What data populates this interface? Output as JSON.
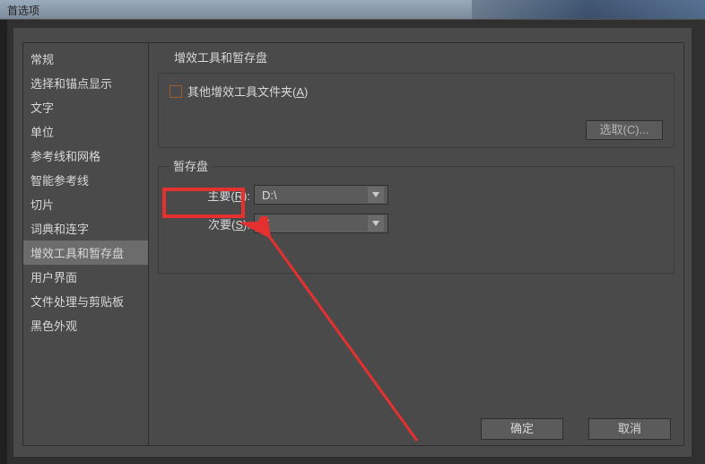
{
  "window": {
    "title": "首选项"
  },
  "sidebar": {
    "items": [
      "常规",
      "选择和锚点显示",
      "文字",
      "单位",
      "参考线和网格",
      "智能参考线",
      "切片",
      "词典和连字",
      "增效工具和暂存盘",
      "用户界面",
      "文件处理与剪贴板",
      "黑色外观"
    ],
    "selected_index": 8
  },
  "content": {
    "section_title": "增效工具和暂存盘",
    "other_folder_label_pre": "其他增效工具文件夹(",
    "other_folder_key": "A",
    "other_folder_label_post": ")",
    "select_button": "选取(C)...",
    "scratch": {
      "legend": "暂存盘",
      "primary_label_pre": "主要(",
      "primary_key": "R",
      "primary_label_post": "):",
      "primary_value": "D:\\",
      "secondary_label_pre": "次要(",
      "secondary_key": "S",
      "secondary_label_post": "):",
      "secondary_value": "E"
    }
  },
  "footer": {
    "ok": "确定",
    "cancel": "取消"
  }
}
